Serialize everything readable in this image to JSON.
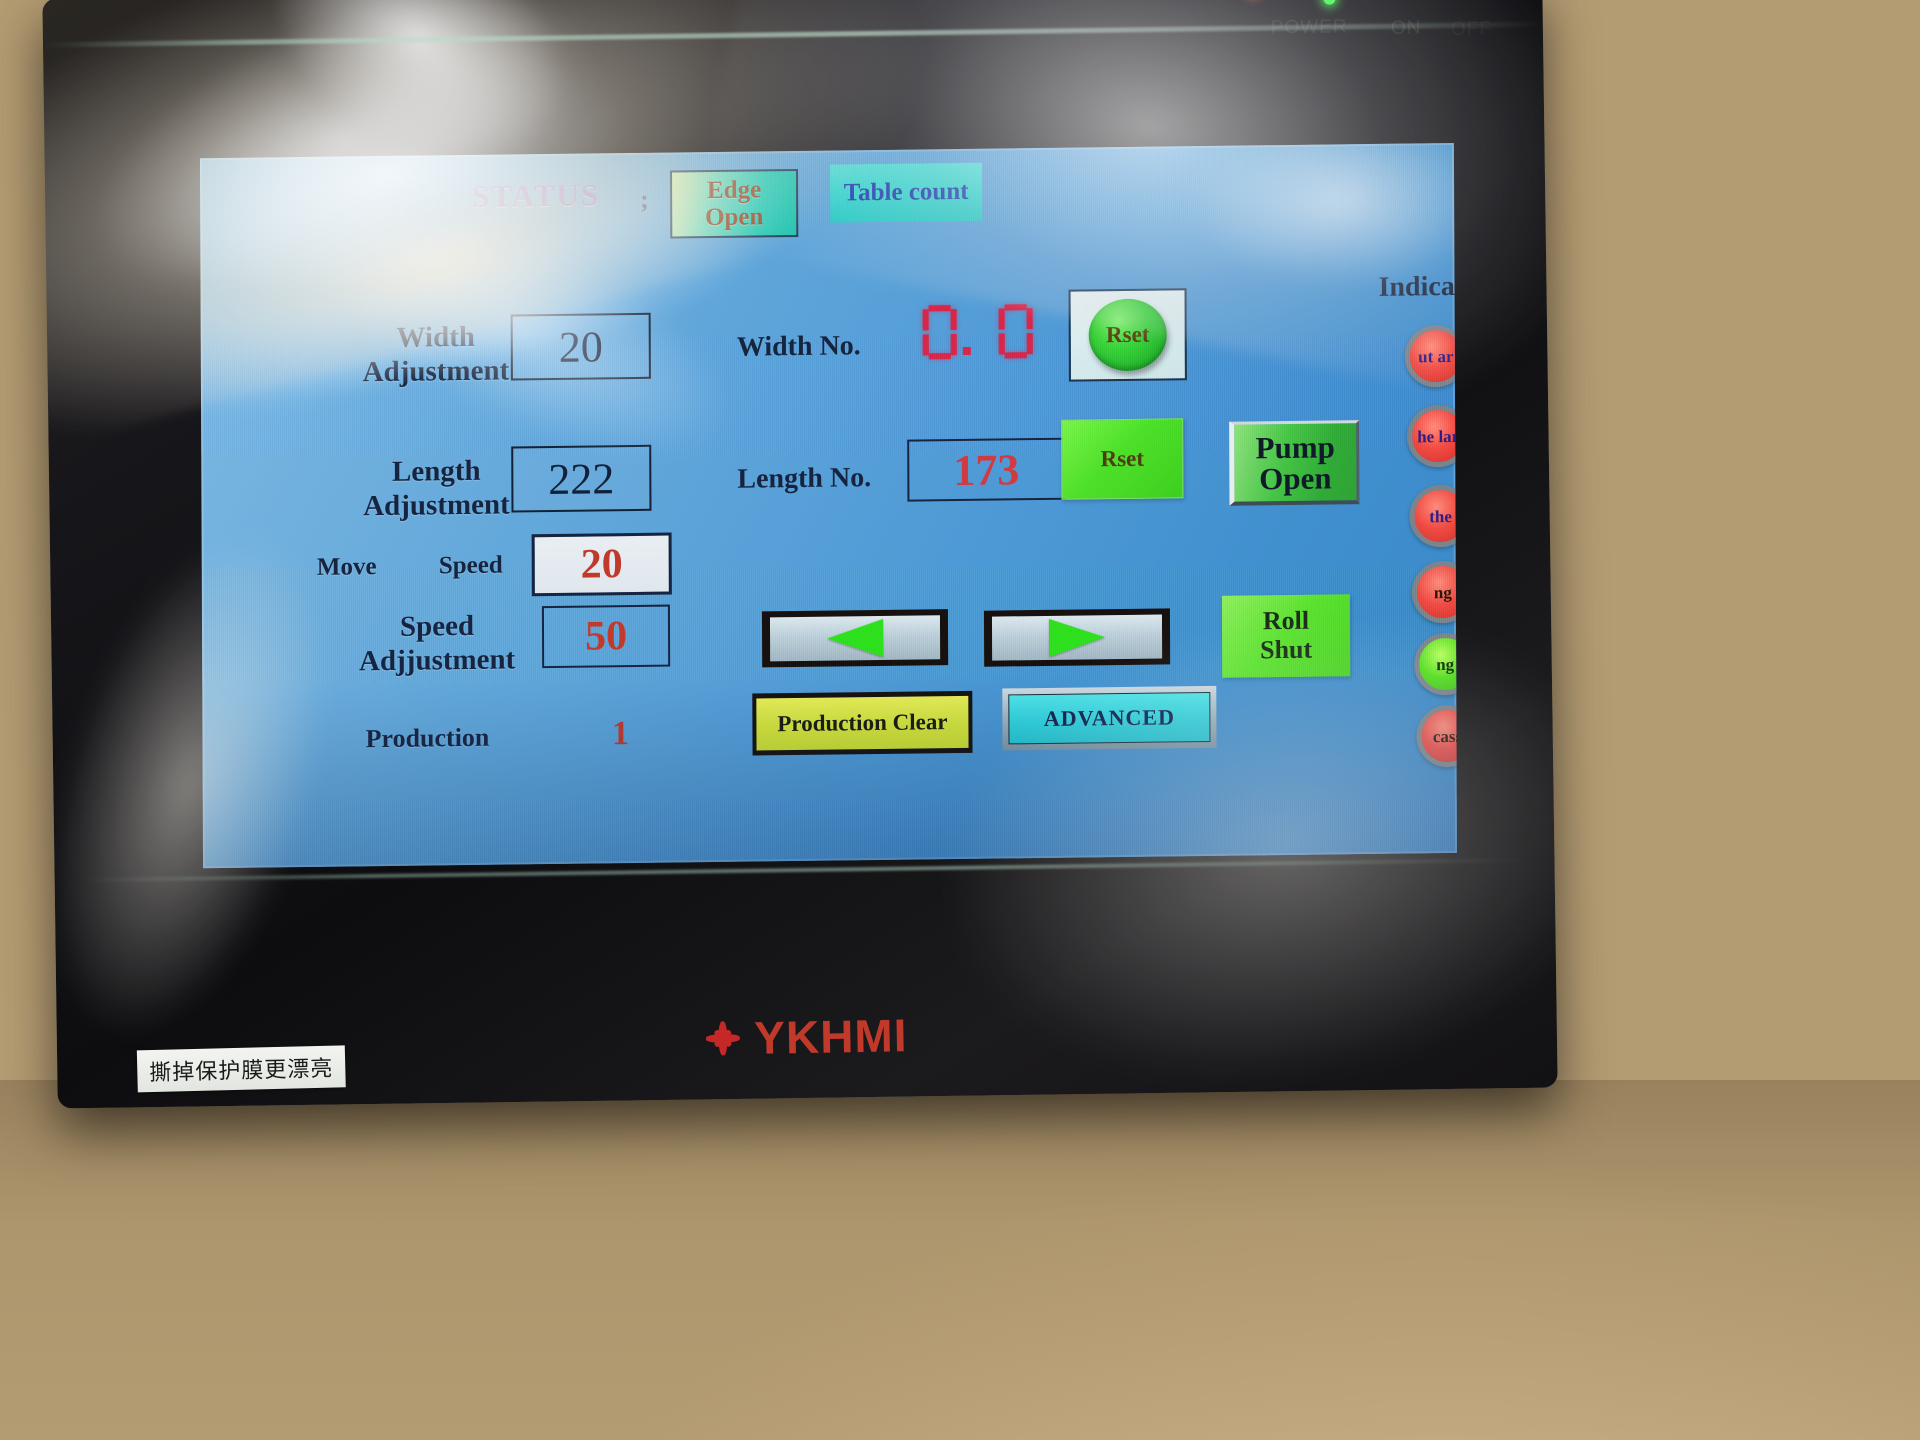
{
  "device": {
    "brand": "YKHMI",
    "film_tab_text": "撕掉保护膜更漂亮",
    "leds": {
      "power_label": "POWER",
      "on_label": "ON",
      "off_label": "OFF"
    }
  },
  "screen": {
    "header": {
      "status_label": "STATUS",
      "status_separator": ";",
      "edge_button": {
        "line1": "Edge",
        "line2": "Open"
      },
      "table_count_button": "Table count"
    },
    "rows": {
      "width_adjustment": {
        "label_line1": "Width",
        "label_line2": "Adjustment",
        "value": "20"
      },
      "length_adjustment": {
        "label_line1": "Length",
        "label_line2": "Adjustment",
        "value": "222"
      },
      "move_speed": {
        "label_move": "Move",
        "label_speed": "Speed",
        "value": "20"
      },
      "speed_adjustment": {
        "label_line1": "Speed",
        "label_line2": "Adjjustment",
        "value": "50"
      },
      "production": {
        "label": "Production",
        "value": "1"
      }
    },
    "readouts": {
      "width_no": {
        "label": "Width No.",
        "value": "0. 0",
        "digits": [
          "0",
          "0"
        ],
        "color": "#d8264a"
      },
      "length_no": {
        "label": "Length No.",
        "value": "173",
        "color": "#d0393f"
      }
    },
    "buttons": {
      "rset_round": "Rset",
      "rset_flat": "Rset",
      "pump_open": {
        "line1": "Pump",
        "line2": "Open"
      },
      "roll_shut": {
        "line1": "Roll",
        "line2": "Shut"
      },
      "jog_left": "left-arrow",
      "jog_right": "right-arrow",
      "production_clear": "Production Clear",
      "advanced": "ADVANCED"
    },
    "indicator": {
      "title": "Indicator",
      "lamps": [
        {
          "text": "ut ar",
          "state": "red"
        },
        {
          "text": "he lar",
          "state": "red"
        },
        {
          "text": "the",
          "state": "red"
        },
        {
          "text": "ng",
          "state": "red"
        },
        {
          "text": "ng",
          "state": "green"
        },
        {
          "text": "cass",
          "state": "red"
        }
      ]
    },
    "colors": {
      "screen_bg": "#4f9ad6",
      "label_text": "#16243f",
      "status_text": "#8c6fd0",
      "value_red": "#c0392b",
      "accent_green": "#3ccf1e",
      "accent_cyan": "#2fd3cc",
      "accent_yellow": "#d7e63a"
    }
  }
}
